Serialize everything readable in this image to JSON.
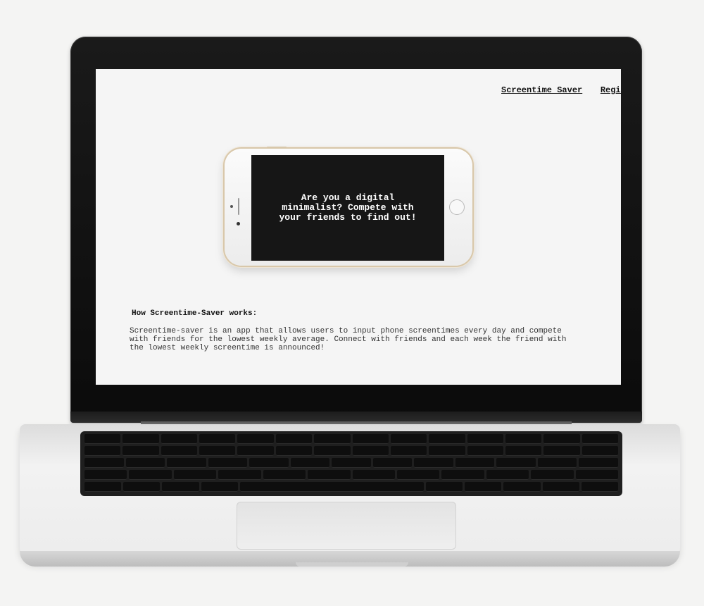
{
  "nav": {
    "brand": "Screentime Saver",
    "register": "Regis"
  },
  "hero": {
    "text": "Are you a digital minimalist? Compete with your friends to find out!"
  },
  "how": {
    "title": "How Screentime-Saver works:",
    "body": "Screentime-saver is an app that allows users to input phone screentimes every day and compete with friends for the lowest weekly average. Connect with friends and each week the friend with the lowest weekly screentime is announced!"
  }
}
